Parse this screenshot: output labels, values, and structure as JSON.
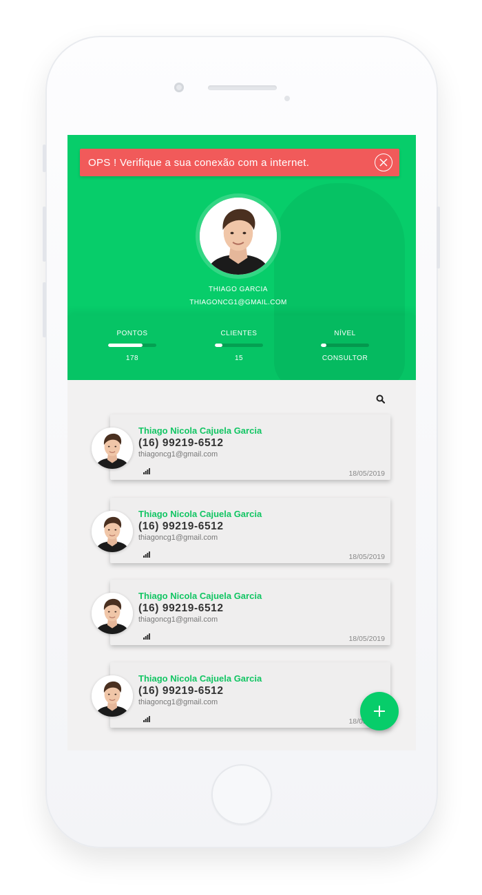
{
  "alert": {
    "message": "OPS ! Verifique a sua conexão com a  internet.",
    "close_icon": "close-circle-icon"
  },
  "profile": {
    "name": "THIAGO GARCIA",
    "email": "THIAGONCG1@GMAIL.COM"
  },
  "stats": [
    {
      "label": "PONTOS",
      "value": "178",
      "progress": 0.72
    },
    {
      "label": "CLIENTES",
      "value": "15",
      "progress": 0.15
    },
    {
      "label": "NÍVEL",
      "value": "CONSULTOR",
      "progress": 0.12
    }
  ],
  "toolbar": {
    "search_icon": "search-icon"
  },
  "contacts": [
    {
      "name": "Thiago Nicola Cajuela Garcia",
      "phone": "(16) 99219-6512",
      "email": "thiagoncg1@gmail.com",
      "date": "18/05/2019"
    },
    {
      "name": "Thiago Nicola Cajuela Garcia",
      "phone": "(16) 99219-6512",
      "email": "thiagoncg1@gmail.com",
      "date": "18/05/2019"
    },
    {
      "name": "Thiago Nicola Cajuela Garcia",
      "phone": "(16) 99219-6512",
      "email": "thiagoncg1@gmail.com",
      "date": "18/05/2019"
    },
    {
      "name": "Thiago Nicola Cajuela Garcia",
      "phone": "(16) 99219-6512",
      "email": "thiagoncg1@gmail.com",
      "date": "18/05/2019"
    }
  ],
  "fab": {
    "icon": "plus-icon"
  },
  "colors": {
    "brand": "#07cd6a",
    "alert": "#f15a5a"
  }
}
